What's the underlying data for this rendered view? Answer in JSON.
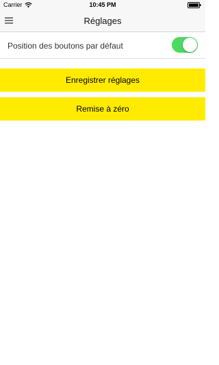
{
  "status_bar": {
    "carrier": "Carrier",
    "time": "10:45 PM",
    "wifi_icon": "wifi-icon",
    "battery_icon": "battery-icon"
  },
  "nav": {
    "title": "Réglages",
    "menu_icon": "hamburger-menu-icon"
  },
  "settings": {
    "default_button_position_label": "Position des boutons par défaut",
    "default_button_position_on": true
  },
  "actions": {
    "save_label": "Enregistrer réglages",
    "reset_label": "Remise à zéro"
  },
  "colors": {
    "button_yellow": "#ffeb00",
    "toggle_on": "#4cd964",
    "nav_background": "#f7f7f7"
  }
}
